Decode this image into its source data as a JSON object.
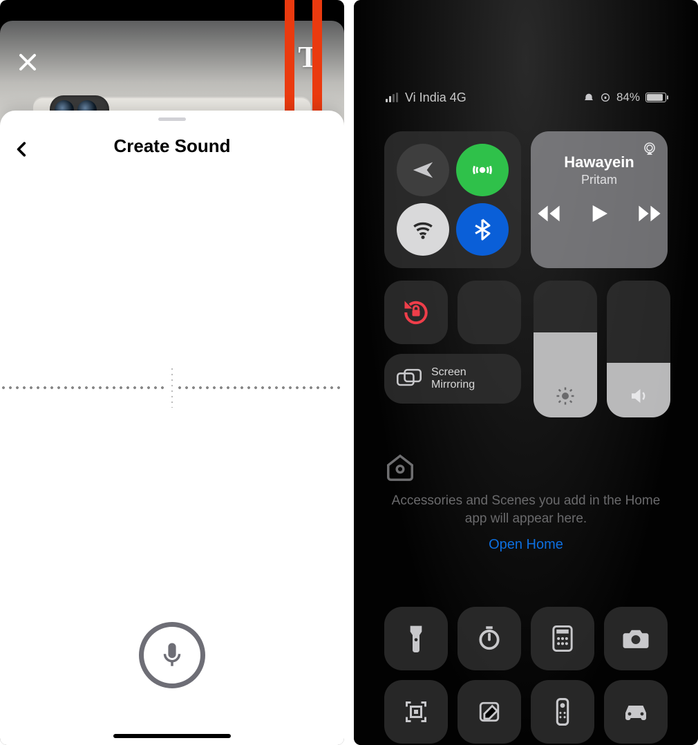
{
  "left": {
    "sheet_title": "Create Sound",
    "text_tool_glyph": "T"
  },
  "right": {
    "status": {
      "carrier": "Vi India 4G",
      "battery_pct": "84%"
    },
    "media": {
      "title": "Hawayein",
      "artist": "Pritam"
    },
    "screen_mirroring_label": "Screen\nMirroring",
    "home": {
      "message": "Accessories and Scenes you add in the Home app will appear here.",
      "link": "Open Home"
    }
  }
}
